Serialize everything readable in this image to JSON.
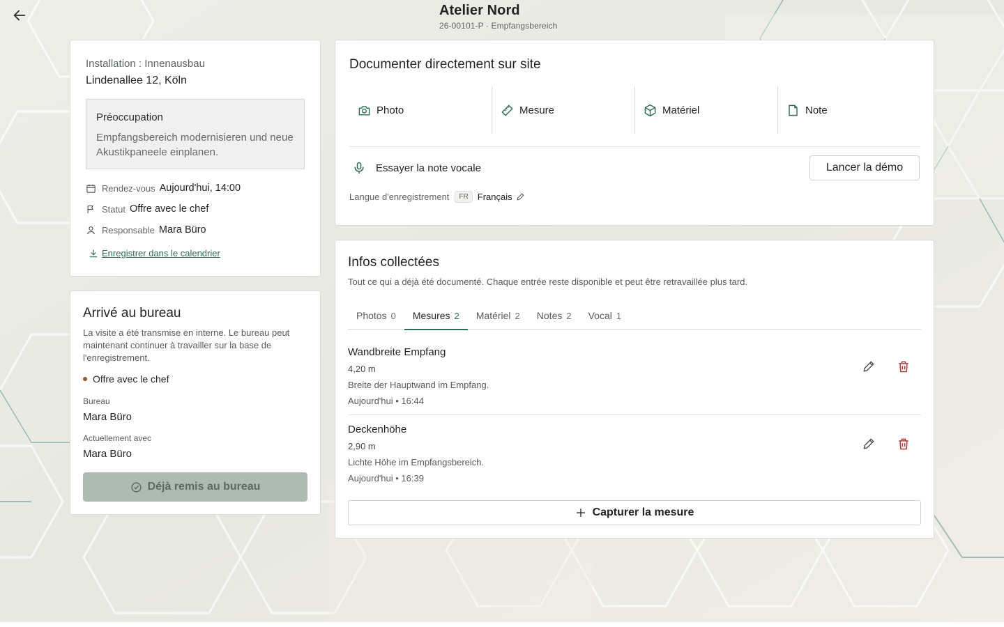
{
  "header": {
    "title": "Atelier Nord",
    "subtitle": "26-00101-P · Empfangsbereich"
  },
  "installation": {
    "kind": "Installation : Innenausbau",
    "address": "Lindenallee 12, Köln",
    "concern_title": "Préoccupation",
    "concern_text": "Empfangsbereich modernisieren und neue Akustikpaneele einplanen.",
    "appointment_label": "Rendez-vous",
    "appointment_value": "Aujourd'hui, 14:00",
    "status_label": "Statut",
    "status_value": "Offre avec le chef",
    "owner_label": "Responsable",
    "owner_value": "Mara Büro",
    "calendar_link": "Enregistrer dans le calendrier"
  },
  "office": {
    "title": "Arrivé au bureau",
    "description": "La visite a été transmise en interne. Le bureau peut maintenant continuer à travailler sur la base de l'enregistrement.",
    "status": "Offre avec le chef",
    "bureau_label": "Bureau",
    "bureau_value": "Mara Büro",
    "current_label": "Actuellement avec",
    "current_value": "Mara Büro",
    "handed_button": "Déjà remis au bureau"
  },
  "documentation": {
    "title": "Documenter directement sur site",
    "tools": [
      {
        "label": "Photo",
        "icon": "camera-icon"
      },
      {
        "label": "Mesure",
        "icon": "ruler-icon"
      },
      {
        "label": "Matériel",
        "icon": "package-icon"
      },
      {
        "label": "Note",
        "icon": "document-icon"
      }
    ],
    "voice_label": "Essayer la note vocale",
    "demo_button": "Lancer la démo",
    "language_label": "Langue d'enregistrement",
    "language_code": "FR",
    "language_value": "Français"
  },
  "collected": {
    "title": "Infos collectées",
    "subtitle": "Tout ce qui a déjà été documenté. Chaque entrée reste disponible et peut être retravaillée plus tard.",
    "tabs": [
      {
        "label": "Photos",
        "count": "0"
      },
      {
        "label": "Mesures",
        "count": "2"
      },
      {
        "label": "Matériel",
        "count": "2"
      },
      {
        "label": "Notes",
        "count": "2"
      },
      {
        "label": "Vocal",
        "count": "1"
      }
    ],
    "active_tab": "Mesures",
    "entries": [
      {
        "name": "Wandbreite Empfang",
        "value": "4,20 m",
        "description": "Breite der Hauptwand im Empfang.",
        "time": "Aujourd'hui • 16:44"
      },
      {
        "name": "Deckenhöhe",
        "value": "2,90 m",
        "description": "Lichte Höhe im Empfangsbereich.",
        "time": "Aujourd'hui • 16:39"
      }
    ],
    "capture_button": "Capturer la mesure"
  },
  "colors": {
    "accent": "#2e6b55",
    "danger": "#b23a3a",
    "status_dot": "#8b5a2b",
    "disabled_button": "#adbbb3"
  }
}
